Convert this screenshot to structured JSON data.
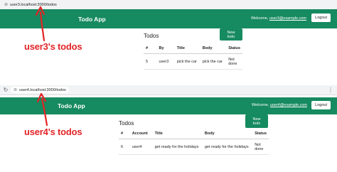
{
  "windows": [
    {
      "url": "user3.localhost:3000/todos",
      "brand": "Todo App",
      "welcome_prefix": "Welcome,",
      "welcome_email": "user3@example.com",
      "logout_label": "Logout",
      "page_title": "Todos",
      "new_todo_label": "New todo",
      "columns": [
        "#",
        "By",
        "Title",
        "Body",
        "Status"
      ],
      "rows": [
        [
          "5",
          "user3",
          "pick the car",
          "pick the car",
          "Not done"
        ]
      ],
      "annotation": "user3's todos"
    },
    {
      "url": "user4.localhost:3000/todos",
      "brand": "Todo App",
      "welcome_prefix": "Welcome,",
      "welcome_email": "user4@example.com",
      "logout_label": "Logout",
      "page_title": "Todos",
      "new_todo_label": "New todo",
      "columns": [
        "#",
        "Account",
        "Title",
        "Body",
        "Status"
      ],
      "rows": [
        [
          "6",
          "user4",
          "get ready for the holidays",
          "get ready for the holidays",
          "Not done"
        ]
      ],
      "annotation": "user4's todos"
    }
  ],
  "icons": {
    "reload": "reload-icon",
    "site_info": "site-info-icon",
    "menu": "kebab-menu-icon"
  },
  "colors": {
    "navbar": "#168a60",
    "annotation": "#e42326"
  }
}
